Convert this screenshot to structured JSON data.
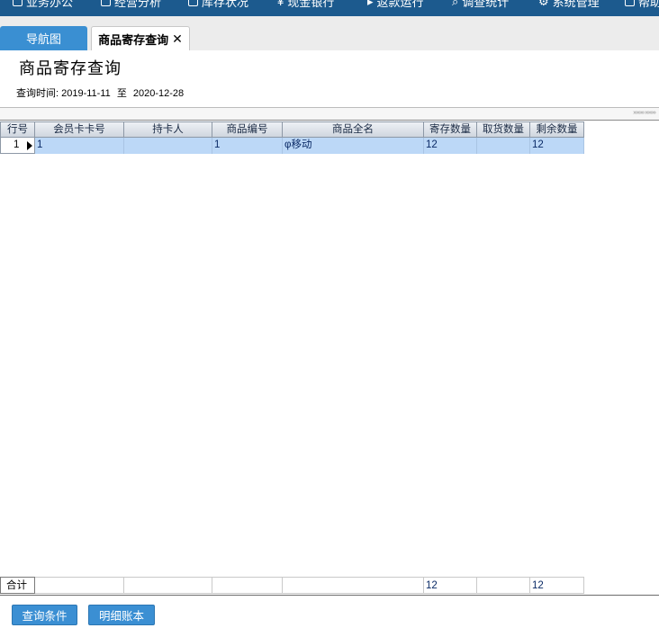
{
  "topnav": {
    "items": [
      {
        "label": "业务办公",
        "icon": "document-icon"
      },
      {
        "label": "经营分析",
        "icon": "chart-icon"
      },
      {
        "label": "库存状况",
        "icon": "warehouse-icon"
      },
      {
        "label": "现金银行",
        "icon": "money-icon"
      },
      {
        "label": "返款运行",
        "icon": "arrow-icon"
      },
      {
        "label": "调查统计",
        "icon": "search-icon"
      },
      {
        "label": "系统管理",
        "icon": "gear-icon"
      },
      {
        "label": "帮助",
        "icon": "book-icon"
      }
    ]
  },
  "tabs": {
    "nav_label": "导航图",
    "active_label": "商品寄存查询",
    "close_glyph": "✕"
  },
  "page": {
    "title": "商品寄存查询",
    "query_label": "查询时间:",
    "date_from": "2019-11-11",
    "date_sep": "至",
    "date_to": "2020-12-28"
  },
  "grid": {
    "columns": [
      "行号",
      "会员卡卡号",
      "持卡人",
      "商品编号",
      "商品全名",
      "寄存数量",
      "取货数量",
      "剩余数量"
    ],
    "rows": [
      {
        "row_no": "1",
        "card_no": "1",
        "holder": "",
        "product_code": "1",
        "product_name": "φ移动",
        "deposit_qty": "12",
        "pickup_qty": "",
        "remaining_qty": "12"
      }
    ],
    "footer": {
      "label": "合计",
      "deposit_qty": "12",
      "remaining_qty": "12"
    }
  },
  "buttons": {
    "query_conditions": "查询条件",
    "detail_ledger": "明细账本"
  },
  "colors": {
    "topbar": "#1c5a8e",
    "tab_nav": "#3a8fd2",
    "row_selected": "#bcd8f7",
    "button": "#3b8fd3"
  }
}
